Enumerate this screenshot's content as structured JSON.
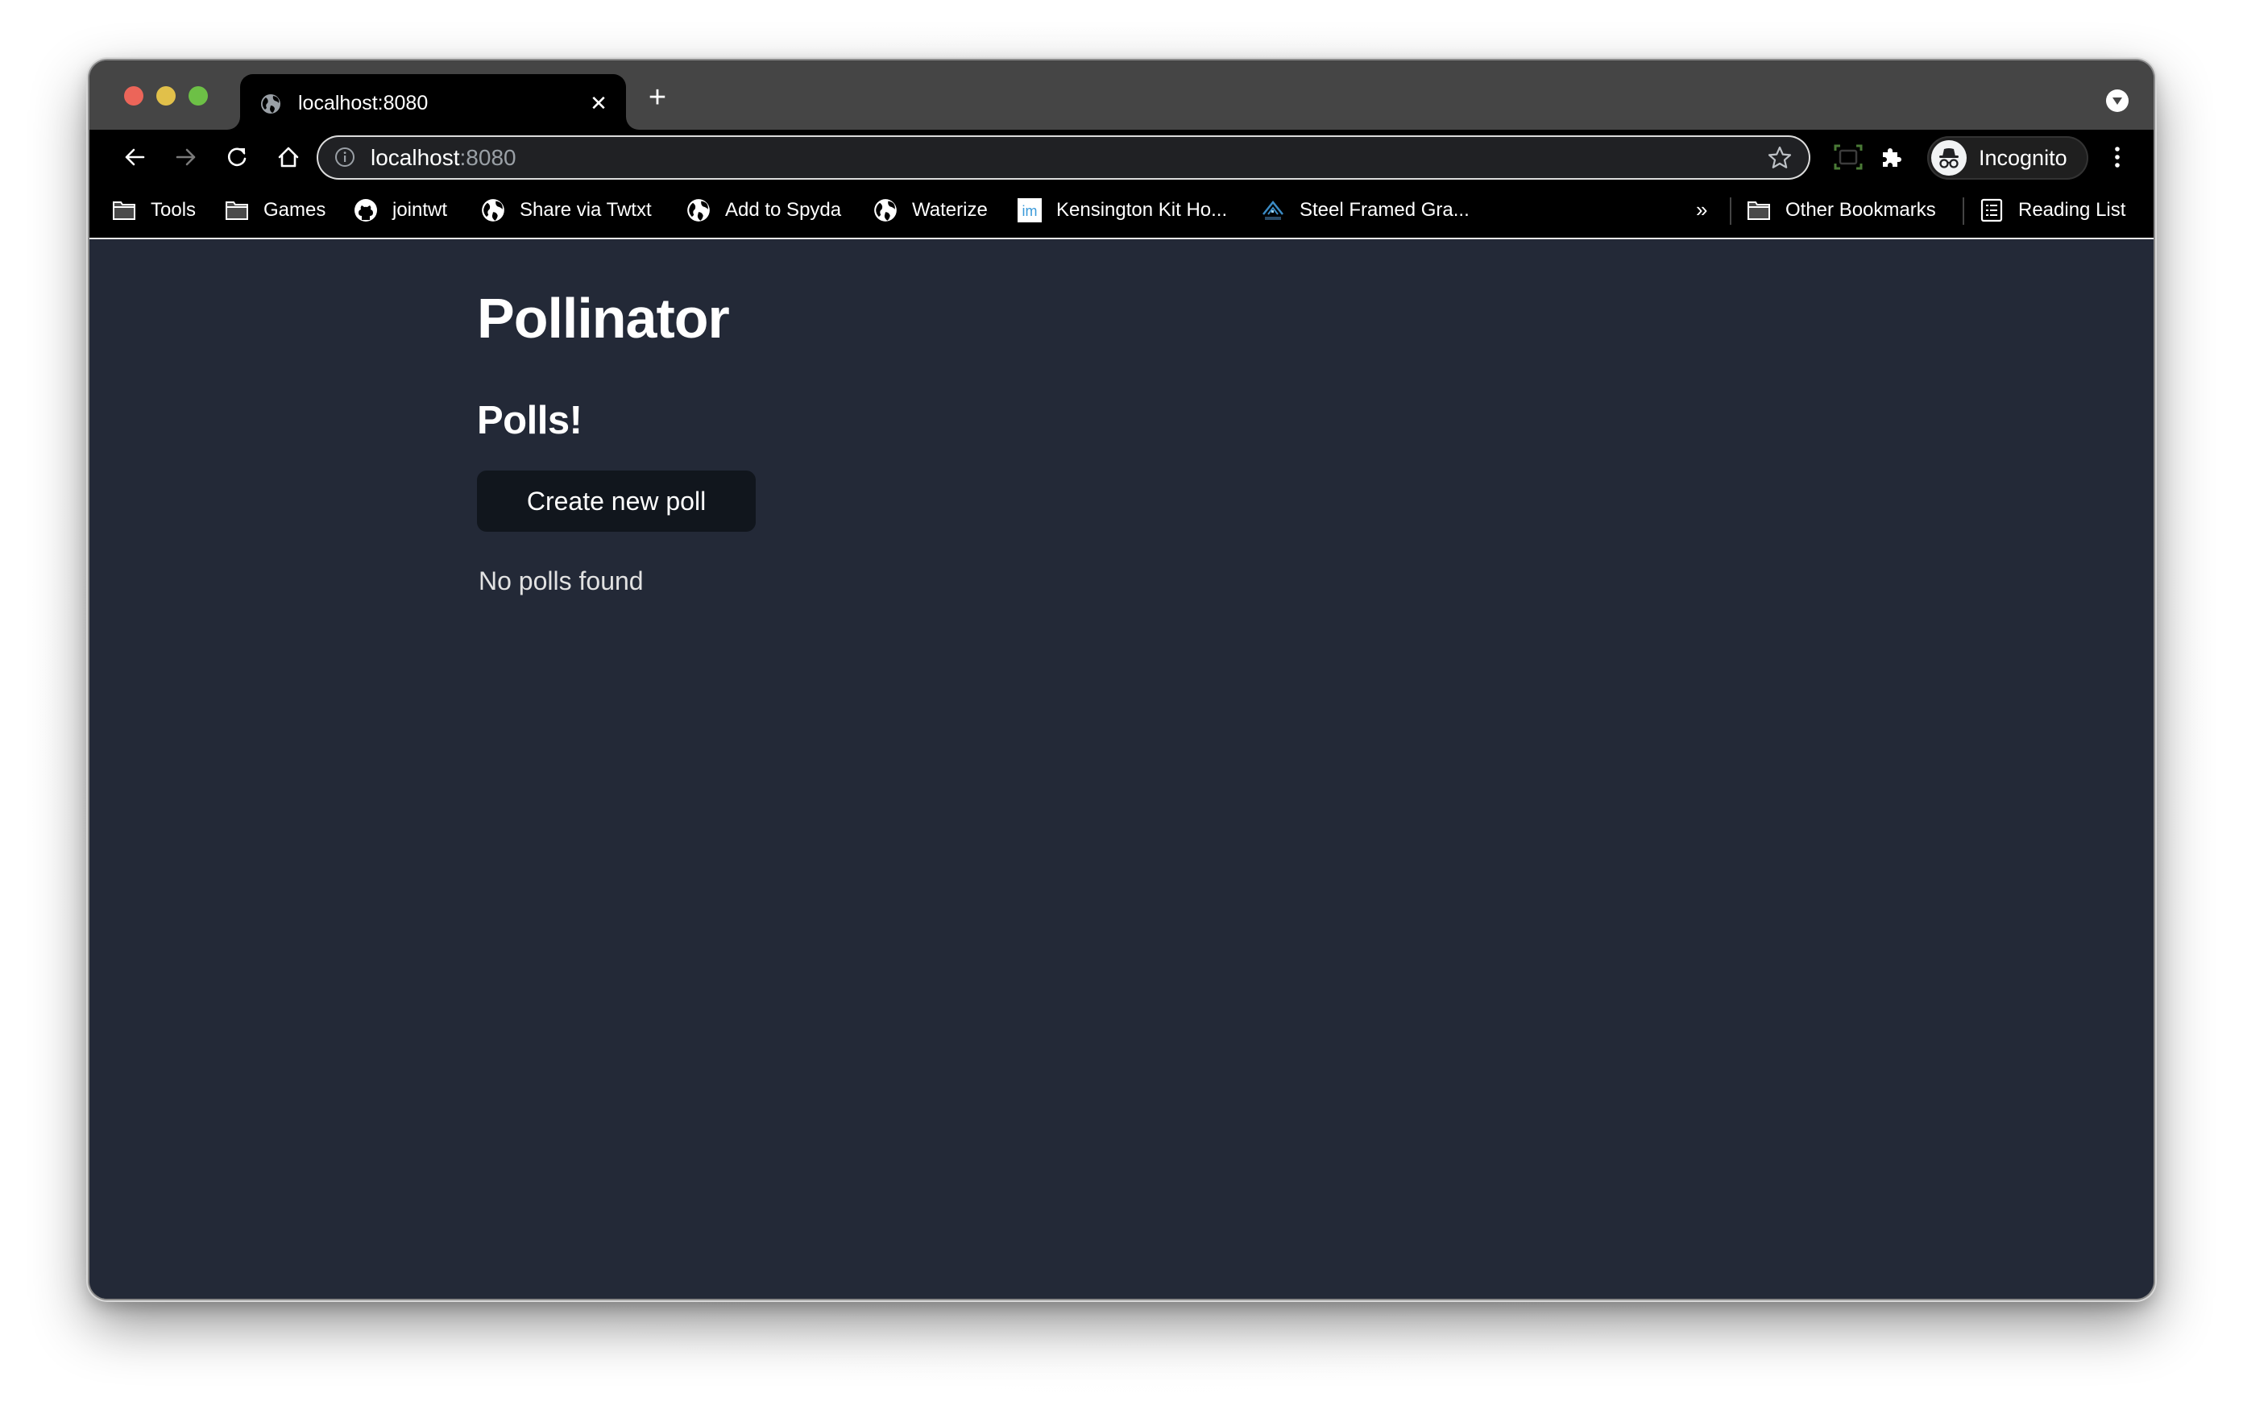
{
  "browser": {
    "tab": {
      "title": "localhost:8080",
      "close_icon": "close-icon",
      "favicon": "globe-icon"
    },
    "new_tab_icon": "plus-icon",
    "tab_search_icon": "chevron-down-circle-icon",
    "toolbar": {
      "back_icon": "arrow-left-icon",
      "forward_icon": "arrow-right-icon",
      "reload_icon": "reload-icon",
      "home_icon": "home-icon",
      "omnibox": {
        "host": "localhost",
        "port": ":8080",
        "info_icon": "info-icon",
        "bookmark_icon": "star-icon"
      },
      "screen_capture_icon": "screen-capture-icon",
      "extensions_icon": "puzzle-icon",
      "profile": {
        "label": "Incognito",
        "icon": "incognito-icon"
      },
      "menu_icon": "kebab-menu-icon"
    },
    "bookmarks": [
      {
        "label": "Tools",
        "icon": "folder-icon"
      },
      {
        "label": "Games",
        "icon": "folder-icon"
      },
      {
        "label": "jointwt",
        "icon": "github-icon"
      },
      {
        "label": "Share via Twtxt",
        "icon": "globe-icon"
      },
      {
        "label": "Add to Spyda",
        "icon": "globe-icon"
      },
      {
        "label": "Waterize",
        "icon": "globe-icon"
      },
      {
        "label": "Kensington Kit Ho...",
        "icon": "im-logo-icon"
      },
      {
        "label": "Steel Framed Gra...",
        "icon": "frame-steel-logo-icon"
      }
    ],
    "bookmarks_overflow": "»",
    "other_bookmarks": {
      "label": "Other Bookmarks",
      "icon": "folder-icon"
    },
    "reading_list": {
      "label": "Reading List",
      "icon": "reading-list-icon"
    }
  },
  "page": {
    "title": "Pollinator",
    "section_title": "Polls!",
    "create_button_label": "Create new poll",
    "empty_message": "No polls found",
    "colors": {
      "background": "#232937",
      "button_background": "#11161d",
      "text": "#ffffff",
      "muted_text": "#e2e2e2"
    }
  }
}
